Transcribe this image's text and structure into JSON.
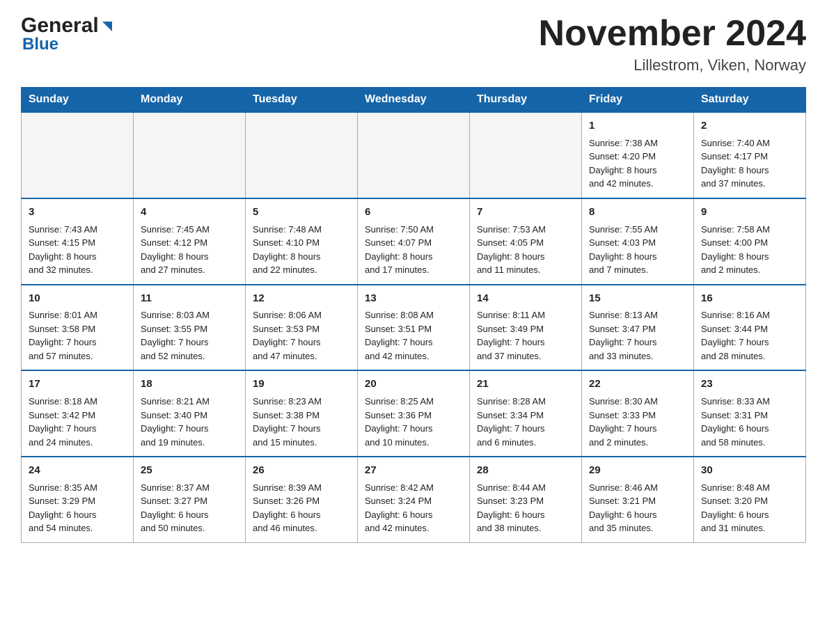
{
  "header": {
    "title": "November 2024",
    "subtitle": "Lillestrom, Viken, Norway"
  },
  "logo": {
    "general": "General",
    "blue": "Blue"
  },
  "days_of_week": [
    "Sunday",
    "Monday",
    "Tuesday",
    "Wednesday",
    "Thursday",
    "Friday",
    "Saturday"
  ],
  "weeks": [
    [
      {
        "day": "",
        "info": ""
      },
      {
        "day": "",
        "info": ""
      },
      {
        "day": "",
        "info": ""
      },
      {
        "day": "",
        "info": ""
      },
      {
        "day": "",
        "info": ""
      },
      {
        "day": "1",
        "info": "Sunrise: 7:38 AM\nSunset: 4:20 PM\nDaylight: 8 hours\nand 42 minutes."
      },
      {
        "day": "2",
        "info": "Sunrise: 7:40 AM\nSunset: 4:17 PM\nDaylight: 8 hours\nand 37 minutes."
      }
    ],
    [
      {
        "day": "3",
        "info": "Sunrise: 7:43 AM\nSunset: 4:15 PM\nDaylight: 8 hours\nand 32 minutes."
      },
      {
        "day": "4",
        "info": "Sunrise: 7:45 AM\nSunset: 4:12 PM\nDaylight: 8 hours\nand 27 minutes."
      },
      {
        "day": "5",
        "info": "Sunrise: 7:48 AM\nSunset: 4:10 PM\nDaylight: 8 hours\nand 22 minutes."
      },
      {
        "day": "6",
        "info": "Sunrise: 7:50 AM\nSunset: 4:07 PM\nDaylight: 8 hours\nand 17 minutes."
      },
      {
        "day": "7",
        "info": "Sunrise: 7:53 AM\nSunset: 4:05 PM\nDaylight: 8 hours\nand 11 minutes."
      },
      {
        "day": "8",
        "info": "Sunrise: 7:55 AM\nSunset: 4:03 PM\nDaylight: 8 hours\nand 7 minutes."
      },
      {
        "day": "9",
        "info": "Sunrise: 7:58 AM\nSunset: 4:00 PM\nDaylight: 8 hours\nand 2 minutes."
      }
    ],
    [
      {
        "day": "10",
        "info": "Sunrise: 8:01 AM\nSunset: 3:58 PM\nDaylight: 7 hours\nand 57 minutes."
      },
      {
        "day": "11",
        "info": "Sunrise: 8:03 AM\nSunset: 3:55 PM\nDaylight: 7 hours\nand 52 minutes."
      },
      {
        "day": "12",
        "info": "Sunrise: 8:06 AM\nSunset: 3:53 PM\nDaylight: 7 hours\nand 47 minutes."
      },
      {
        "day": "13",
        "info": "Sunrise: 8:08 AM\nSunset: 3:51 PM\nDaylight: 7 hours\nand 42 minutes."
      },
      {
        "day": "14",
        "info": "Sunrise: 8:11 AM\nSunset: 3:49 PM\nDaylight: 7 hours\nand 37 minutes."
      },
      {
        "day": "15",
        "info": "Sunrise: 8:13 AM\nSunset: 3:47 PM\nDaylight: 7 hours\nand 33 minutes."
      },
      {
        "day": "16",
        "info": "Sunrise: 8:16 AM\nSunset: 3:44 PM\nDaylight: 7 hours\nand 28 minutes."
      }
    ],
    [
      {
        "day": "17",
        "info": "Sunrise: 8:18 AM\nSunset: 3:42 PM\nDaylight: 7 hours\nand 24 minutes."
      },
      {
        "day": "18",
        "info": "Sunrise: 8:21 AM\nSunset: 3:40 PM\nDaylight: 7 hours\nand 19 minutes."
      },
      {
        "day": "19",
        "info": "Sunrise: 8:23 AM\nSunset: 3:38 PM\nDaylight: 7 hours\nand 15 minutes."
      },
      {
        "day": "20",
        "info": "Sunrise: 8:25 AM\nSunset: 3:36 PM\nDaylight: 7 hours\nand 10 minutes."
      },
      {
        "day": "21",
        "info": "Sunrise: 8:28 AM\nSunset: 3:34 PM\nDaylight: 7 hours\nand 6 minutes."
      },
      {
        "day": "22",
        "info": "Sunrise: 8:30 AM\nSunset: 3:33 PM\nDaylight: 7 hours\nand 2 minutes."
      },
      {
        "day": "23",
        "info": "Sunrise: 8:33 AM\nSunset: 3:31 PM\nDaylight: 6 hours\nand 58 minutes."
      }
    ],
    [
      {
        "day": "24",
        "info": "Sunrise: 8:35 AM\nSunset: 3:29 PM\nDaylight: 6 hours\nand 54 minutes."
      },
      {
        "day": "25",
        "info": "Sunrise: 8:37 AM\nSunset: 3:27 PM\nDaylight: 6 hours\nand 50 minutes."
      },
      {
        "day": "26",
        "info": "Sunrise: 8:39 AM\nSunset: 3:26 PM\nDaylight: 6 hours\nand 46 minutes."
      },
      {
        "day": "27",
        "info": "Sunrise: 8:42 AM\nSunset: 3:24 PM\nDaylight: 6 hours\nand 42 minutes."
      },
      {
        "day": "28",
        "info": "Sunrise: 8:44 AM\nSunset: 3:23 PM\nDaylight: 6 hours\nand 38 minutes."
      },
      {
        "day": "29",
        "info": "Sunrise: 8:46 AM\nSunset: 3:21 PM\nDaylight: 6 hours\nand 35 minutes."
      },
      {
        "day": "30",
        "info": "Sunrise: 8:48 AM\nSunset: 3:20 PM\nDaylight: 6 hours\nand 31 minutes."
      }
    ]
  ]
}
